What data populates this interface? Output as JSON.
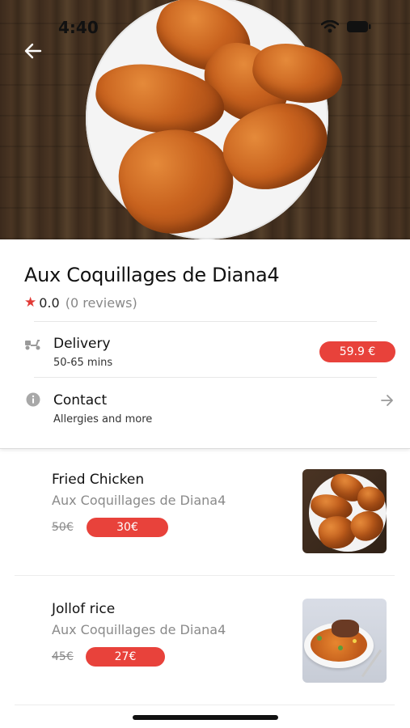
{
  "status_bar": {
    "time": "4:40"
  },
  "restaurant": {
    "name": "Aux Coquillages de Diana4",
    "rating": "0.0",
    "reviews": "(0 reviews)"
  },
  "delivery": {
    "title": "Delivery",
    "time": "50-65 mins",
    "price": "59.9 €"
  },
  "contact": {
    "title": "Contact",
    "subtitle": "Allergies and more"
  },
  "menu": {
    "items": [
      {
        "name": "Fried Chicken",
        "restaurant": "Aux Coquillages de Diana4",
        "old_price": "50€",
        "price": "30€"
      },
      {
        "name": "Jollof rice",
        "restaurant": "Aux Coquillages de Diana4",
        "old_price": "45€",
        "price": "27€"
      }
    ]
  },
  "colors": {
    "accent": "#e8423b",
    "star": "#e13a36"
  },
  "icons": [
    "back-arrow-icon",
    "wifi-icon",
    "battery-icon",
    "scooter-icon",
    "info-icon",
    "arrow-right-icon",
    "star-icon"
  ]
}
